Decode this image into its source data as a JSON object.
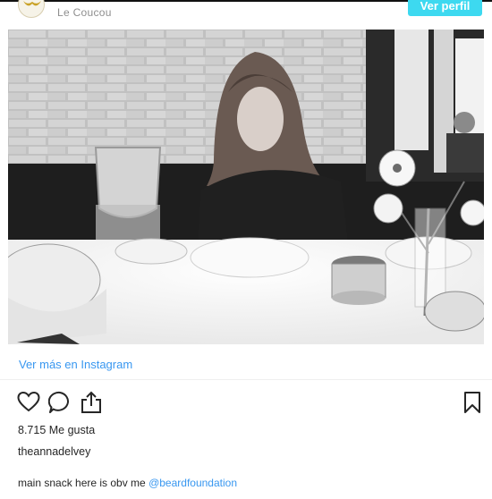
{
  "header": {
    "account_name": "Le Coucou",
    "view_profile_label": "Ver perfil"
  },
  "post": {
    "photo_alt": "",
    "view_more_label": "Ver más en Instagram",
    "likes_text": "8.715 Me gusta",
    "username": "theannadelvey",
    "caption_text": "main snack here is obv me",
    "caption_mention": "@beardfoundation"
  },
  "actions": {
    "icons": [
      "heart-icon",
      "comment-icon",
      "share-icon",
      "bookmark-icon"
    ]
  },
  "colors": {
    "link": "#3897f0",
    "profile_button": "#3dd9f0",
    "text": "#262626"
  }
}
